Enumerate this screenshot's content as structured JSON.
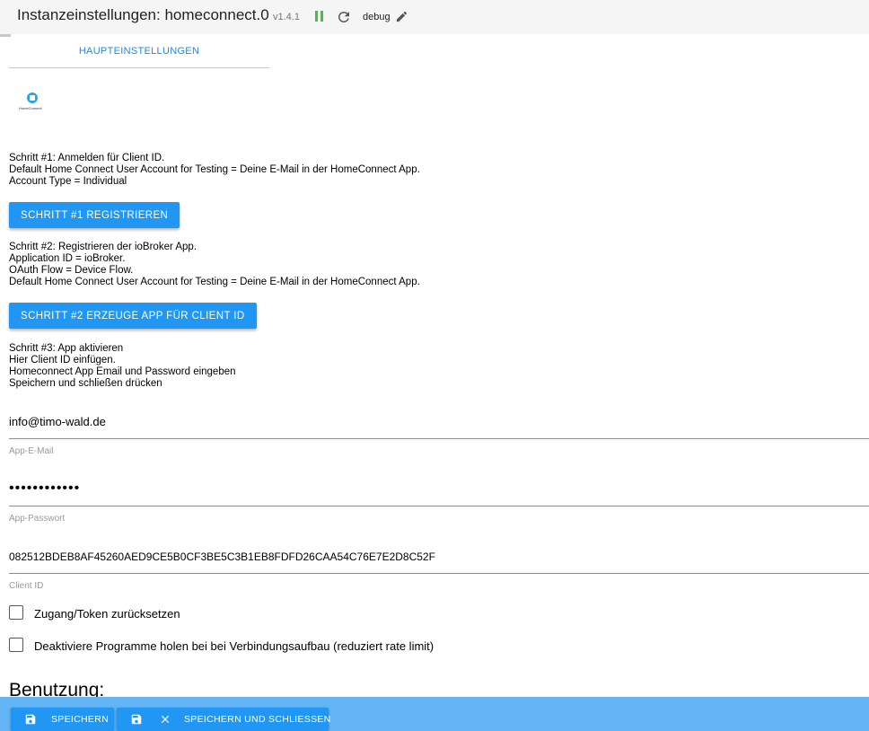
{
  "header": {
    "title": "Instanzeinstellungen: homeconnect.0",
    "version": "v1.4.1",
    "log_level": "debug",
    "colors": {
      "running": "#3ec43e",
      "accent": "#2196f3"
    }
  },
  "tabs": [
    {
      "label": "HAUPTEINSTELLUNGEN",
      "active": true
    }
  ],
  "logo": {
    "text": "HomeConnect",
    "icon": "home-connect-logo"
  },
  "step1": {
    "lines": [
      "Schritt #1: Anmelden für Client ID.",
      "Default Home Connect User Account for Testing = Deine E-Mail in der HomeConnect App.",
      "Account Type = Individual"
    ],
    "button": "SCHRITT #1 REGISTRIEREN"
  },
  "step2": {
    "lines": [
      "Schritt #2: Registrieren der ioBroker App.",
      "Application ID = ioBroker.",
      "OAuth Flow = Device Flow.",
      "Default Home Connect User Account for Testing = Deine E-Mail in der HomeConnect App."
    ],
    "button": "SCHRITT #2 ERZEUGE APP FÜR CLIENT ID"
  },
  "step3": {
    "lines": [
      "Schritt #3: App aktivieren",
      "Hier Client ID einfügen.",
      "Homeconnect App Email und Password eingeben",
      "Speichern und schließen drücken"
    ]
  },
  "fields": {
    "email": {
      "value": "info@timo-wald.de",
      "label": "App-E-Mail"
    },
    "password": {
      "value": "••••••••••••",
      "label": "App-Passwort"
    },
    "client_id": {
      "value": "082512BDEB8AF45260AED9CE5B0CF3BE5C3B1EB8FDFD26CAA54C76E7E2D8C52F",
      "label": "Client ID"
    }
  },
  "checkboxes": [
    {
      "label": "Zugang/Token zurücksetzen",
      "checked": false
    },
    {
      "label": "Deaktiviere Programme holen bei bei Verbindungsaufbau (reduziert rate limit)",
      "checked": false
    }
  ],
  "section_heading": "Benutzung:",
  "footer": {
    "save": "SPEICHERN",
    "save_close": "SPEICHERN UND SCHLIESSEN"
  }
}
